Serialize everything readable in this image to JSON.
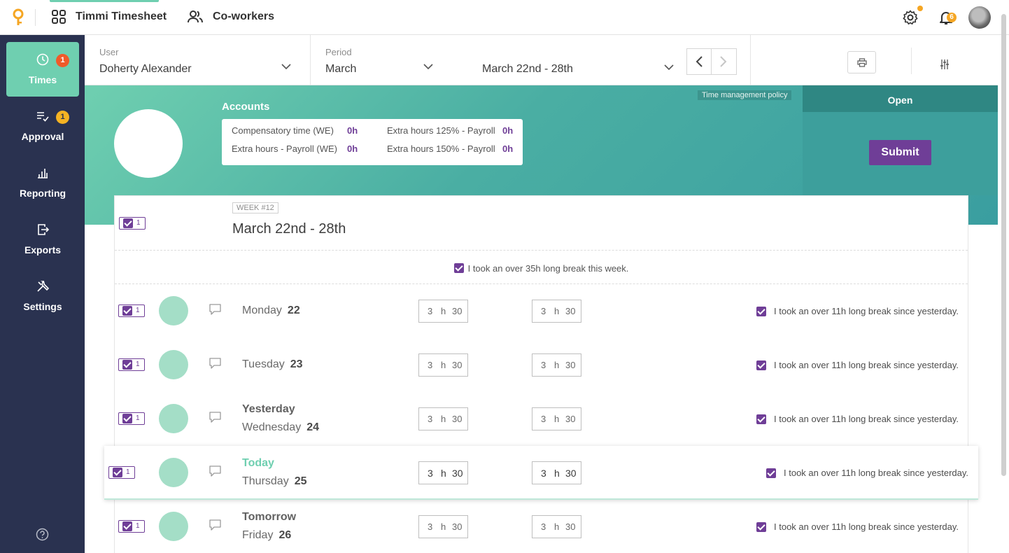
{
  "topbar": {
    "app_name": "Timmi Timesheet",
    "coworkers": "Co-workers",
    "notifications_count": "6",
    "colors": {
      "accent": "#6fcfb0",
      "badge": "#f5a623"
    }
  },
  "sidebar": {
    "items": [
      {
        "label": "Times",
        "badge": "1",
        "icon": "clock-icon"
      },
      {
        "label": "Approval",
        "badge": "1",
        "icon": "checklist-icon"
      },
      {
        "label": "Reporting",
        "icon": "bar-chart-icon"
      },
      {
        "label": "Exports",
        "icon": "export-icon"
      },
      {
        "label": "Settings",
        "icon": "tools-icon"
      }
    ]
  },
  "filters": {
    "user_label": "User",
    "user_value": "Doherty Alexander",
    "period_label": "Period",
    "period_value": "March",
    "range_value": "March 22nd - 28th"
  },
  "hero": {
    "policy": "Time management policy",
    "accounts_title": "Accounts",
    "accounts": [
      {
        "label": "Compensatory time (WE)",
        "value": "0h"
      },
      {
        "label": "Extra hours 125% - Payroll",
        "value": "0h"
      },
      {
        "label": "Extra hours - Payroll (WE)",
        "value": "0h"
      },
      {
        "label": "Extra hours 150% - Payroll",
        "value": "0h"
      }
    ],
    "status": "Open",
    "submit": "Submit"
  },
  "week": {
    "tag": "WEEK #12",
    "title": "March 22nd - 28th",
    "check_count": "1",
    "week_break": "I took an over 35h long break this week."
  },
  "days": [
    {
      "relative": "",
      "name": "Monday",
      "num": "22",
      "count": "1",
      "h1": "3",
      "u1": "h",
      "m1": "30",
      "h2": "3",
      "u2": "h",
      "m2": "30",
      "break": "I took an over 11h long break since yesterday."
    },
    {
      "relative": "",
      "name": "Tuesday",
      "num": "23",
      "count": "1",
      "h1": "3",
      "u1": "h",
      "m1": "30",
      "h2": "3",
      "u2": "h",
      "m2": "30",
      "break": "I took an over 11h long break since yesterday."
    },
    {
      "relative": "Yesterday",
      "name": "Wednesday",
      "num": "24",
      "count": "1",
      "h1": "3",
      "u1": "h",
      "m1": "30",
      "h2": "3",
      "u2": "h",
      "m2": "30",
      "break": "I took an over 11h long break since yesterday."
    },
    {
      "relative": "Today",
      "name": "Thursday",
      "num": "25",
      "count": "1",
      "h1": "3",
      "u1": "h",
      "m1": "30",
      "h2": "3",
      "u2": "h",
      "m2": "30",
      "break": "I took an over 11h long break since yesterday."
    },
    {
      "relative": "Tomorrow",
      "name": "Friday",
      "num": "26",
      "count": "1",
      "h1": "3",
      "u1": "h",
      "m1": "30",
      "h2": "3",
      "u2": "h",
      "m2": "30",
      "break": "I took an over 11h long break since yesterday."
    }
  ]
}
